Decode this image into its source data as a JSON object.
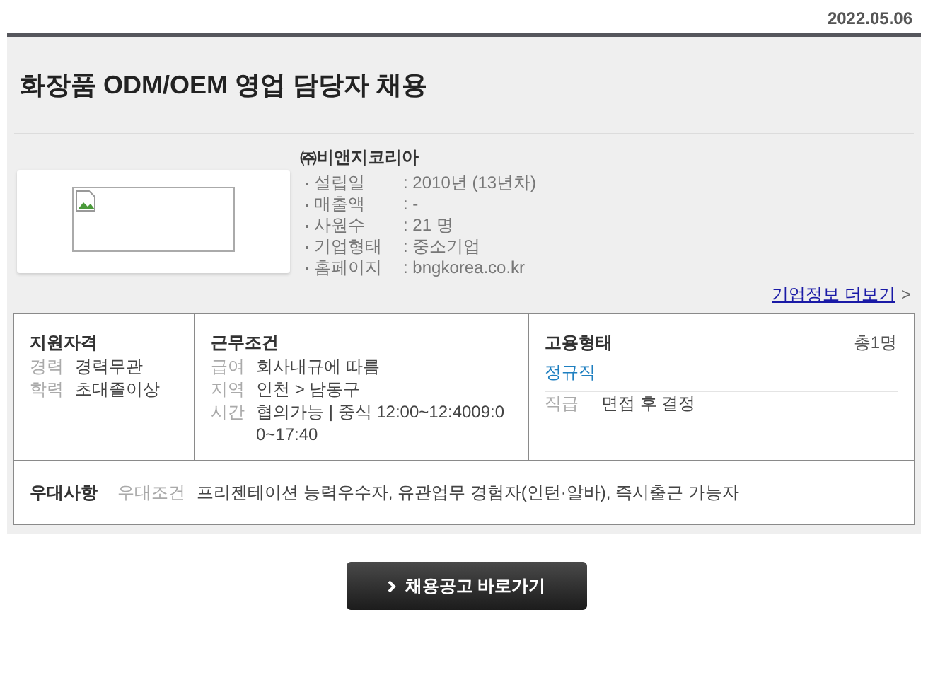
{
  "date": "2022.05.06",
  "title": "화장품 ODM/OEM 영업 담당자 채용",
  "company": {
    "name": "㈜비앤지코리아",
    "facts": [
      {
        "label": "설립일",
        "value": ": 2010년 (13년차)"
      },
      {
        "label": "매출액",
        "value": ": -"
      },
      {
        "label": "사원수",
        "value": ": 21 명"
      },
      {
        "label": "기업형태",
        "value": ": 중소기업"
      },
      {
        "label": "홈페이지",
        "value": ": bngkorea.co.kr"
      }
    ],
    "more_link": "기업정보 더보기",
    "more_arrow": ">"
  },
  "sections": [
    {
      "heading": "지원자격",
      "rows": [
        {
          "label": "경력",
          "value": "경력무관"
        },
        {
          "label": "학력",
          "value": "초대졸이상"
        }
      ]
    },
    {
      "heading": "근무조건",
      "rows": [
        {
          "label": "급여",
          "value": "회사내규에 따름"
        },
        {
          "label": "지역",
          "value": "인천 > 남동구"
        },
        {
          "label": "시간",
          "value": "협의가능 | 중식 12:00~12:4009:00~17:40"
        }
      ]
    },
    {
      "heading": "고용형태",
      "count": "총1명",
      "type": "정규직",
      "rows": [
        {
          "label": "직급",
          "value": "면접 후 결정"
        }
      ]
    }
  ],
  "preferences": {
    "heading": "우대사항",
    "label": "우대조건",
    "value": "프리젠테이션 능력우수자, 유관업무 경험자(인턴·알바), 즉시출근 가능자"
  },
  "apply_button": "채용공고 바로가기"
}
